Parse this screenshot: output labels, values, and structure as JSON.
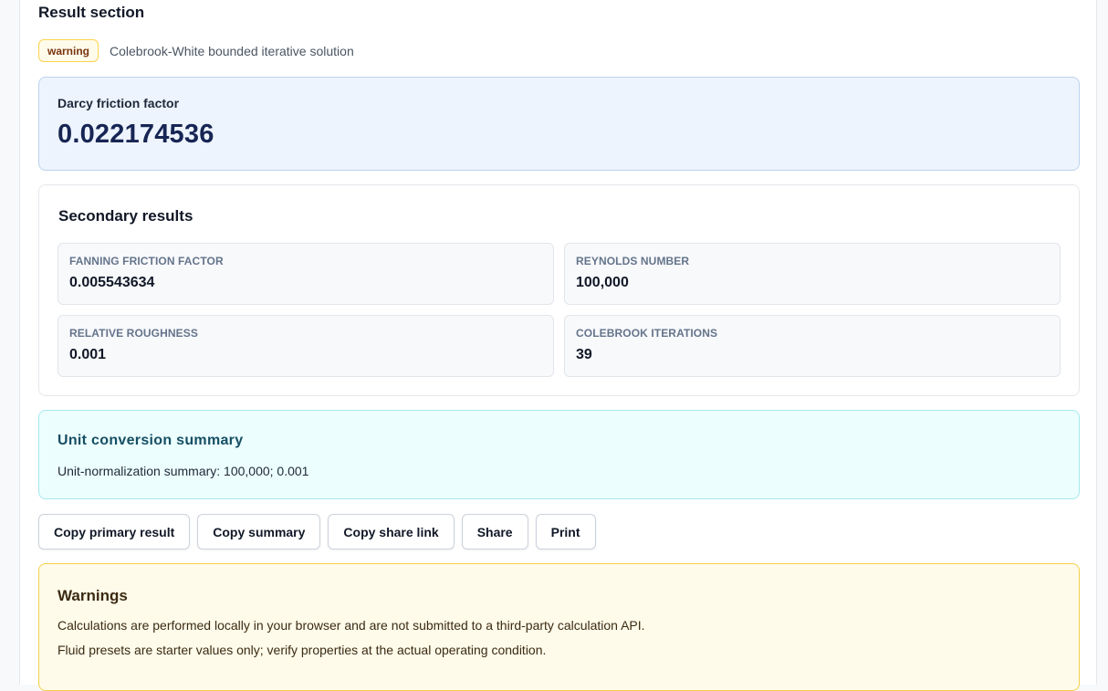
{
  "section": {
    "title": "Result section"
  },
  "status": {
    "badge": "warning",
    "method": "Colebrook-White bounded iterative solution",
    "badge_color": "#fffbeb"
  },
  "primary": {
    "label": "Darcy friction factor",
    "value": "0.022174536"
  },
  "secondary": {
    "title": "Secondary results",
    "metrics": [
      {
        "label": "FANNING FRICTION FACTOR",
        "value": "0.005543634"
      },
      {
        "label": "REYNOLDS NUMBER",
        "value": "100,000"
      },
      {
        "label": "RELATIVE ROUGHNESS",
        "value": "0.001"
      },
      {
        "label": "COLEBROOK ITERATIONS",
        "value": "39"
      }
    ]
  },
  "conversion": {
    "title": "Unit conversion summary",
    "text": "Unit-normalization summary: 100,000; 0.001"
  },
  "actions": {
    "copy_primary": "Copy primary result",
    "copy_summary": "Copy summary",
    "copy_share_link": "Copy share link",
    "share": "Share",
    "print": "Print"
  },
  "warnings": {
    "title": "Warnings",
    "items": [
      "Calculations are performed locally in your browser and are not submitted to a third-party calculation API.",
      "Fluid presets are starter values only; verify properties at the actual operating condition."
    ]
  }
}
